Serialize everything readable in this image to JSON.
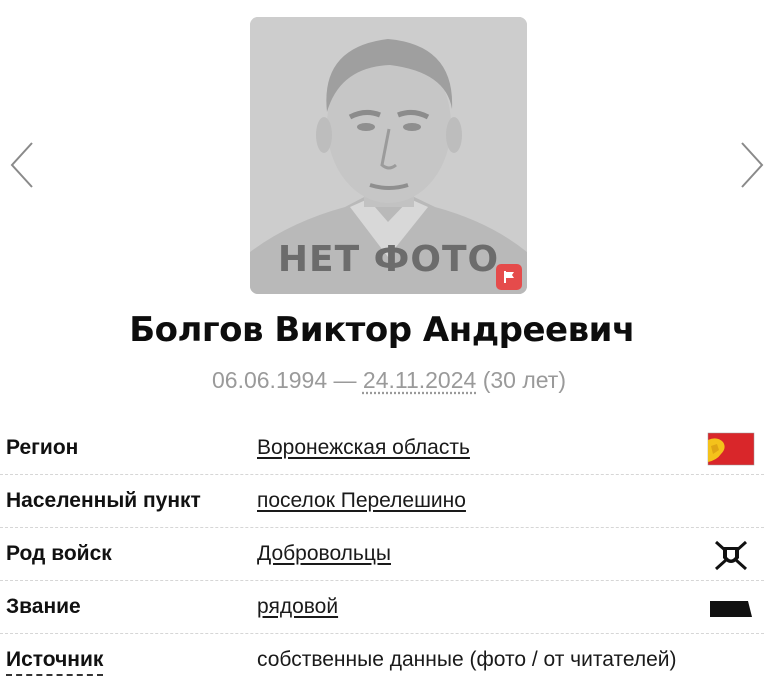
{
  "gallery": {
    "prev_label": "previous photo",
    "next_label": "next photo",
    "placeholder_text": "НЕТ ФОТО"
  },
  "person": {
    "name": "Болгов Виктор Андреевич",
    "birth_date": "06.06.1994",
    "date_separator": " — ",
    "death_date": "24.11.2024",
    "age": " (30 лет)"
  },
  "details": {
    "region": {
      "label": "Регион",
      "value": "Воронежская область",
      "icon": "region-flag-icon"
    },
    "settlement": {
      "label": "Населенный пункт",
      "value": "поселок Перелешино"
    },
    "branch": {
      "label": "Род войск",
      "value": "Добровольцы",
      "icon": "volunteers-emblem-icon"
    },
    "rank": {
      "label": "Звание",
      "value": "рядовой",
      "icon": "rank-insignia-icon"
    },
    "source": {
      "label": "Источник",
      "value": "собственные данные (фото / от читателей)"
    }
  },
  "colors": {
    "flag_red": "#e54b4b",
    "region_flag_red": "#d9262a",
    "region_flag_yellow": "#f4c21b",
    "muted_text": "#9a9a9a"
  }
}
